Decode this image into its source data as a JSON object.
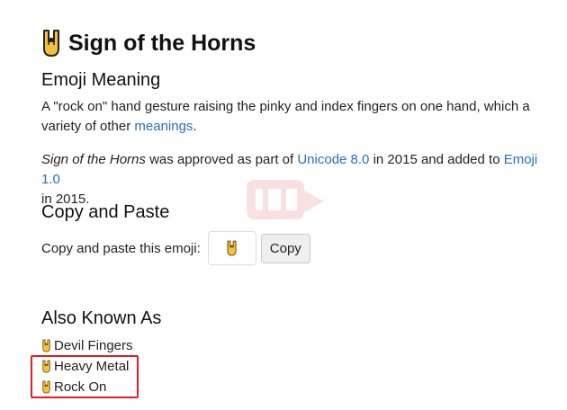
{
  "header": {
    "emoji_icon": "sign-of-the-horns-emoji",
    "title": "Sign of the Horns"
  },
  "meaning": {
    "heading": "Emoji Meaning",
    "text_before_link": "A \"rock on\" hand gesture raising the pinky and index fingers on one hand, which a variety of other ",
    "link": "meanings",
    "text_after_link": "."
  },
  "history": {
    "name_italic": "Sign of the Horns",
    "text_1": " was approved as part of ",
    "link_unicode": "Unicode 8.0",
    "text_2": " in 2015 and added to ",
    "link_emoji": "Emoji 1.0",
    "text_3": " in 2015."
  },
  "copy": {
    "heading": "Copy and Paste",
    "label": "Copy and paste this emoji:",
    "emoji": "sign-of-the-horns-emoji",
    "button": "Copy"
  },
  "aka": {
    "heading": "Also Known As",
    "items": [
      {
        "label": "Devil Fingers"
      },
      {
        "label": "Heavy Metal"
      },
      {
        "label": "Rock On"
      }
    ]
  },
  "colors": {
    "link": "#2a6fb8",
    "highlight": "#e01c24",
    "emoji_yellow": "#f5c23a"
  }
}
